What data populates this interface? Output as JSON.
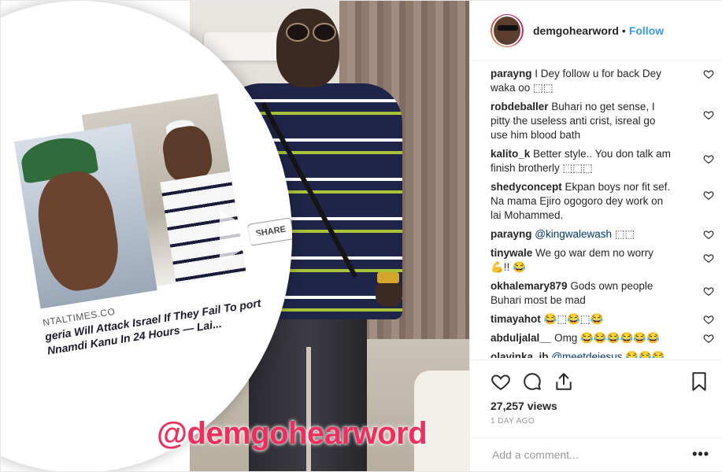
{
  "post": {
    "username": "demgohearword",
    "follow_label": "Follow",
    "dot": "•",
    "views": "27,257 views",
    "date": "1 DAY AGO",
    "add_comment_placeholder": "Add a comment...",
    "more_label": "•••"
  },
  "media": {
    "watermark": "@demgohearword",
    "share_label": "SHARE",
    "source_text": "NTALTIMES.CO",
    "headline": "geria Will Attack Israel If They Fail To port Nnamdi Kanu In 24 Hours — Lai..."
  },
  "comments": [
    {
      "user": "parayng",
      "text": "I Dey follow u for back Dey waka oo ⬚⬚"
    },
    {
      "user": "robdeballer",
      "text": "Buhari no get sense, I pitty the useless anti crist, isreal go use him blood bath"
    },
    {
      "user": "kalito_k",
      "text": "Better style.. You don talk am finish brotherly ⬚⬚⬚"
    },
    {
      "user": "shedyconcept",
      "text": "Ekpan boys nor fit sef. Na mama Ejiro ogogoro dey work on lai Mohammed."
    },
    {
      "user": "parayng",
      "mention": "@kingwalewash",
      "text": " ⬚⬚"
    },
    {
      "user": "tinywale",
      "text": "We go war dem no worry 💪!! 😂"
    },
    {
      "user": "okhalemary879",
      "text": "Gods own people Buhari most be mad"
    },
    {
      "user": "timayahot",
      "text": "😂⬚😂⬚😂"
    },
    {
      "user": "abduljalal__",
      "text": "Omg 😂😂😂😂😂😂"
    },
    {
      "user": "olavinka_ib",
      "mention": "@meetdejesus",
      "text": " 😂😂😂"
    }
  ],
  "icons": {
    "like": "heart-icon",
    "comment": "comment-icon",
    "share": "share-icon",
    "save": "bookmark-icon"
  },
  "colors": {
    "link": "#3897f0",
    "watermark": "#ee2f5e",
    "muted": "#999999"
  }
}
